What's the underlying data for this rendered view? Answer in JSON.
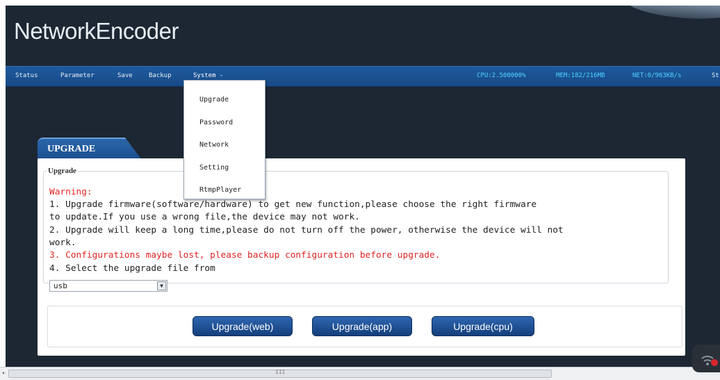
{
  "app": {
    "title": "NetworkEncoder"
  },
  "menu": {
    "items": [
      "Status",
      "Parameter",
      "Save",
      "Backup",
      "System -"
    ],
    "overflow": "St"
  },
  "stats": {
    "cpu": "CPU:2.500000%",
    "mem": "MEM:182/216MB",
    "net": "NET:0/903KB/s"
  },
  "system_menu": {
    "items": [
      "Upgrade",
      "Password",
      "Network",
      "Setting",
      "RtmpPlayer"
    ]
  },
  "tab": {
    "label": "UPGRADE"
  },
  "upgrade": {
    "legend": "Upgrade",
    "warning": "Warning:",
    "lines": [
      "1. Upgrade firmware(software/hardware) to get new function,please choose the right firmware",
      "to update.If you use a wrong file,the device may not work.",
      "2. Upgrade will keep a long time,please do not turn off the power, otherwise the device will not",
      "work.",
      "3. Configurations maybe lost, please backup configuration before upgrade.",
      "4. Select the upgrade file from"
    ],
    "source": {
      "selected": "usb"
    }
  },
  "buttons": {
    "web": "Upgrade(web)",
    "app": "Upgrade(app)",
    "cpu": "Upgrade(cpu)"
  },
  "scrollbar": {
    "grip": "III",
    "left_arrow": "◂"
  },
  "colors": {
    "background": "#1d2733",
    "menubar": "#1b4f8d",
    "stat_text": "#4fd4ff",
    "warning": "#e02424",
    "button": "#1f4f94"
  }
}
